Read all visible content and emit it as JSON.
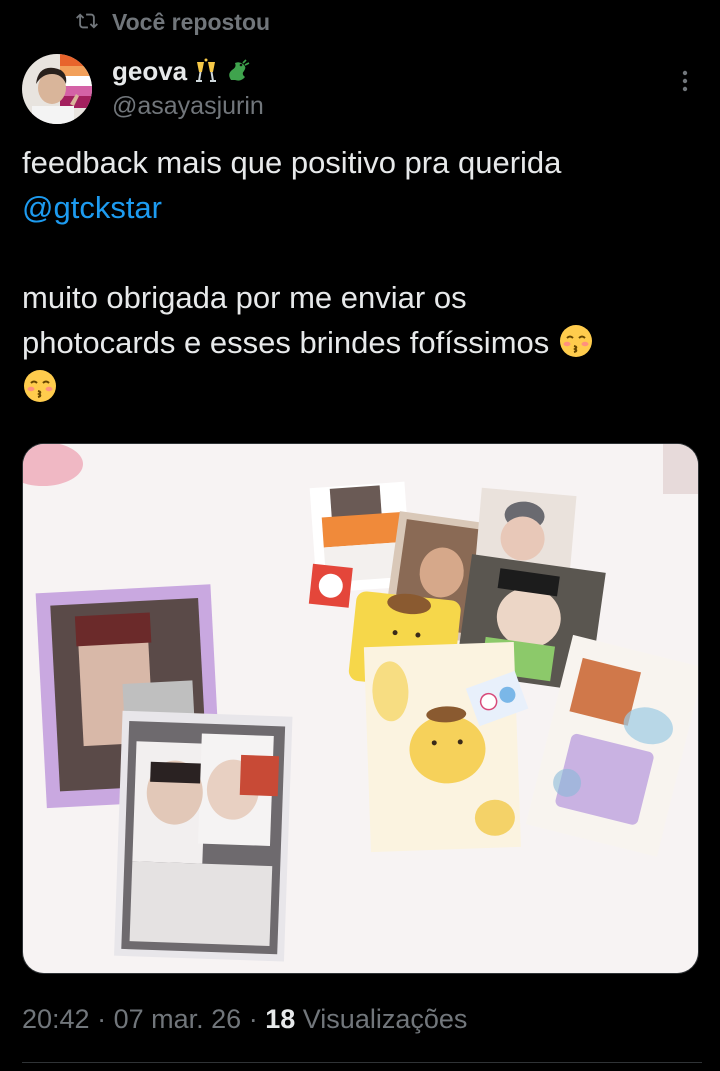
{
  "repost": {
    "label": "Você repostou",
    "icon": "repost-icon"
  },
  "author": {
    "display_name": "geova",
    "display_emojis": [
      "clinking-glasses-emoji",
      "dragon-emoji"
    ],
    "handle": "@asayasjurin",
    "avatar": "avatar-photo"
  },
  "tweet": {
    "line1": "feedback mais que positivo pra querida",
    "mention": "@gtckstar",
    "line3": "muito obrigada por me enviar os",
    "line4": "photocards e esses brindes fofíssimos",
    "emoji": "kissing-face-with-closed-eyes-emoji"
  },
  "media": {
    "description_icon": "photo-of-photocards"
  },
  "meta": {
    "time": "20:42",
    "sep1": "·",
    "date": "07 mar. 26",
    "sep2": "·",
    "views_count": "18",
    "views_label": "Visualizações"
  },
  "colors": {
    "background": "#000000",
    "text": "#e7e9ea",
    "secondary": "#71767b",
    "link": "#1d9bf0",
    "border": "#2f3336"
  }
}
